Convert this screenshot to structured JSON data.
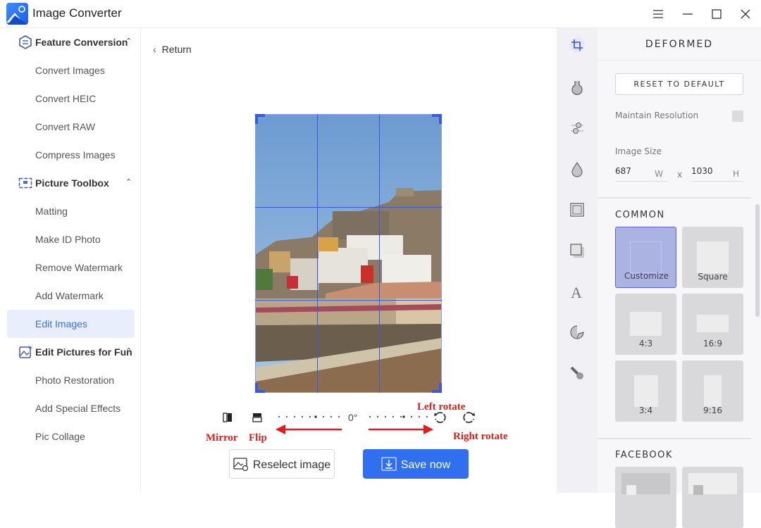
{
  "app": {
    "title": "Image Converter",
    "window_controls": [
      "menu-icon",
      "minimize-icon",
      "maximize-icon",
      "close-icon"
    ]
  },
  "sidebar": {
    "groups": [
      {
        "label": "Feature Conversion",
        "icon": "convert-icon",
        "expanded": true,
        "items": [
          {
            "label": "Convert Images"
          },
          {
            "label": "Convert HEIC"
          },
          {
            "label": "Convert RAW"
          },
          {
            "label": "Compress Images"
          }
        ]
      },
      {
        "label": "Picture Toolbox",
        "icon": "toolbox-icon",
        "expanded": true,
        "items": [
          {
            "label": "Matting"
          },
          {
            "label": "Make ID Photo"
          },
          {
            "label": "Remove Watermark"
          },
          {
            "label": "Add Watermark"
          },
          {
            "label": "Edit Images",
            "active": true
          }
        ]
      },
      {
        "label": "Edit Pictures for Fun",
        "icon": "fun-picture-icon",
        "expanded": true,
        "items": [
          {
            "label": "Photo Restoration"
          },
          {
            "label": "Add Special Effects"
          },
          {
            "label": "Pic Collage"
          }
        ]
      }
    ]
  },
  "main": {
    "return_label": "Return",
    "rotation_value": "0°",
    "reselect_label": "Reselect image",
    "save_label": "Save now",
    "annotations": {
      "mirror": "Mirror",
      "flip": "Flip",
      "left_rotate": "Left rotate",
      "right_rotate": "Right rotate"
    }
  },
  "toolstrip": {
    "tools": [
      "crop-icon",
      "flask-icon",
      "adjust-sliders-icon",
      "drop-icon",
      "frame-icon",
      "shadow-square-icon",
      "text-icon",
      "sticker-icon",
      "brush-icon"
    ],
    "active": "crop-icon"
  },
  "panel": {
    "title": "DEFORMED",
    "reset_label": "RESET TO DEFAULT",
    "maintain_resolution_label": "Maintain Resolution",
    "maintain_resolution_checked": false,
    "image_size_label": "Image Size",
    "width": "687",
    "width_unit": "W",
    "times": "x",
    "height": "1030",
    "height_unit": "H",
    "common_label": "COMMON",
    "presets": [
      {
        "label": "Customize",
        "selected": true
      },
      {
        "label": "Square"
      },
      {
        "label": "4:3"
      },
      {
        "label": "16:9"
      },
      {
        "label": "3:4"
      },
      {
        "label": "9:16"
      }
    ],
    "facebook_label": "FACEBOOK"
  },
  "colors": {
    "accent": "#2f6ff0",
    "active_item_bg": "#e8eefb",
    "annotation_red": "#e31b1b",
    "crop_grid": "#3a5bd9"
  }
}
